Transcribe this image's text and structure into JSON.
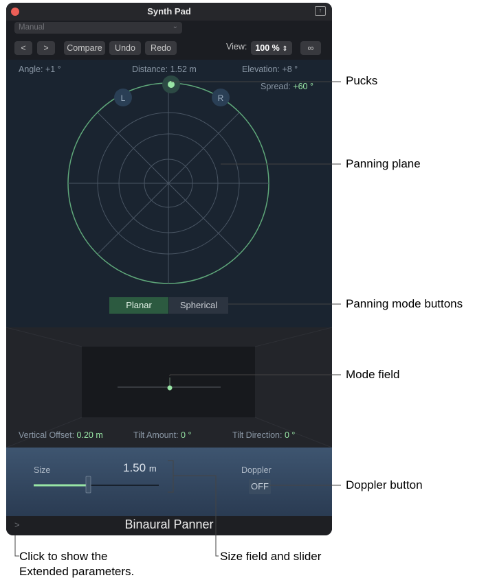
{
  "window": {
    "title": "Synth Pad",
    "preset": "Manual",
    "toolbar": {
      "back": "<",
      "forward": ">",
      "compare": "Compare",
      "undo": "Undo",
      "redo": "Redo",
      "view_label": "View:",
      "view_value": "100 %"
    }
  },
  "panner": {
    "angle_label": "Angle:",
    "angle_value": "+1 °",
    "distance_label": "Distance:",
    "distance_value": "1.52 m",
    "elevation_label": "Elevation:",
    "elevation_value": "+8 °",
    "spread_label": "Spread:",
    "spread_value": "+60 °",
    "puck_left": "L",
    "puck_right": "R",
    "mode_buttons": [
      "Planar",
      "Spherical"
    ],
    "active_mode": "Planar"
  },
  "mode_field": {
    "vertical_offset_label": "Vertical Offset:",
    "vertical_offset_value": "0.20 m",
    "tilt_amount_label": "Tilt Amount:",
    "tilt_amount_value": "0 °",
    "tilt_direction_label": "Tilt Direction:",
    "tilt_direction_value": "0 °"
  },
  "controls": {
    "size_label": "Size",
    "size_value": "1.50",
    "size_unit": "m",
    "doppler_label": "Doppler",
    "doppler_value": "OFF"
  },
  "footer": {
    "plugin_name": "Binaural Panner",
    "expand_glyph": ">"
  },
  "annotations": {
    "pucks": "Pucks",
    "panning_plane": "Panning plane",
    "panning_mode_buttons": "Panning mode buttons",
    "mode_field": "Mode field",
    "doppler_button": "Doppler button",
    "extended_line1": "Click to show the",
    "extended_line2": "Extended parameters.",
    "size_field": "Size field and slider"
  },
  "colors": {
    "accent_green": "#98e5a5",
    "panner_bg": "#1a2430",
    "window_bg": "#1b1d22"
  }
}
